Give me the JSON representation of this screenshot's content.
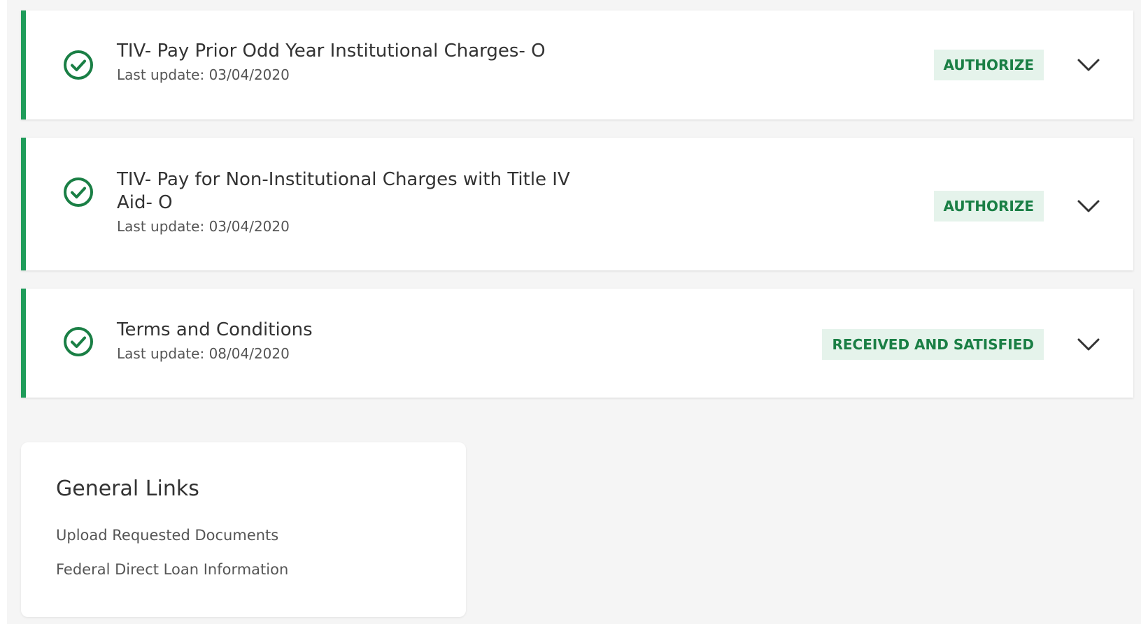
{
  "colors": {
    "accent": "#1f9c5a",
    "badge_background": "#e5f3eb",
    "badge_text": "#1a7f45",
    "page_background": "#f5f5f5"
  },
  "requirements": [
    {
      "title": "TIV- Pay Prior Odd Year Institutional Charges- O",
      "last_update": "Last update: 03/04/2020",
      "status": "AUTHORIZE",
      "status_icon": "check-circle-icon",
      "expand_icon": "chevron-down-icon"
    },
    {
      "title": "TIV- Pay for Non-Institutional Charges with Title IV Aid- O",
      "last_update": "Last update: 03/04/2020",
      "status": "AUTHORIZE",
      "status_icon": "check-circle-icon",
      "expand_icon": "chevron-down-icon"
    },
    {
      "title": "Terms and Conditions",
      "last_update": "Last update: 08/04/2020",
      "status": "RECEIVED AND SATISFIED",
      "status_icon": "check-circle-icon",
      "expand_icon": "chevron-down-icon"
    }
  ],
  "general_links": {
    "title": "General Links",
    "links": [
      "Upload Requested Documents",
      "Federal Direct Loan Information"
    ]
  }
}
